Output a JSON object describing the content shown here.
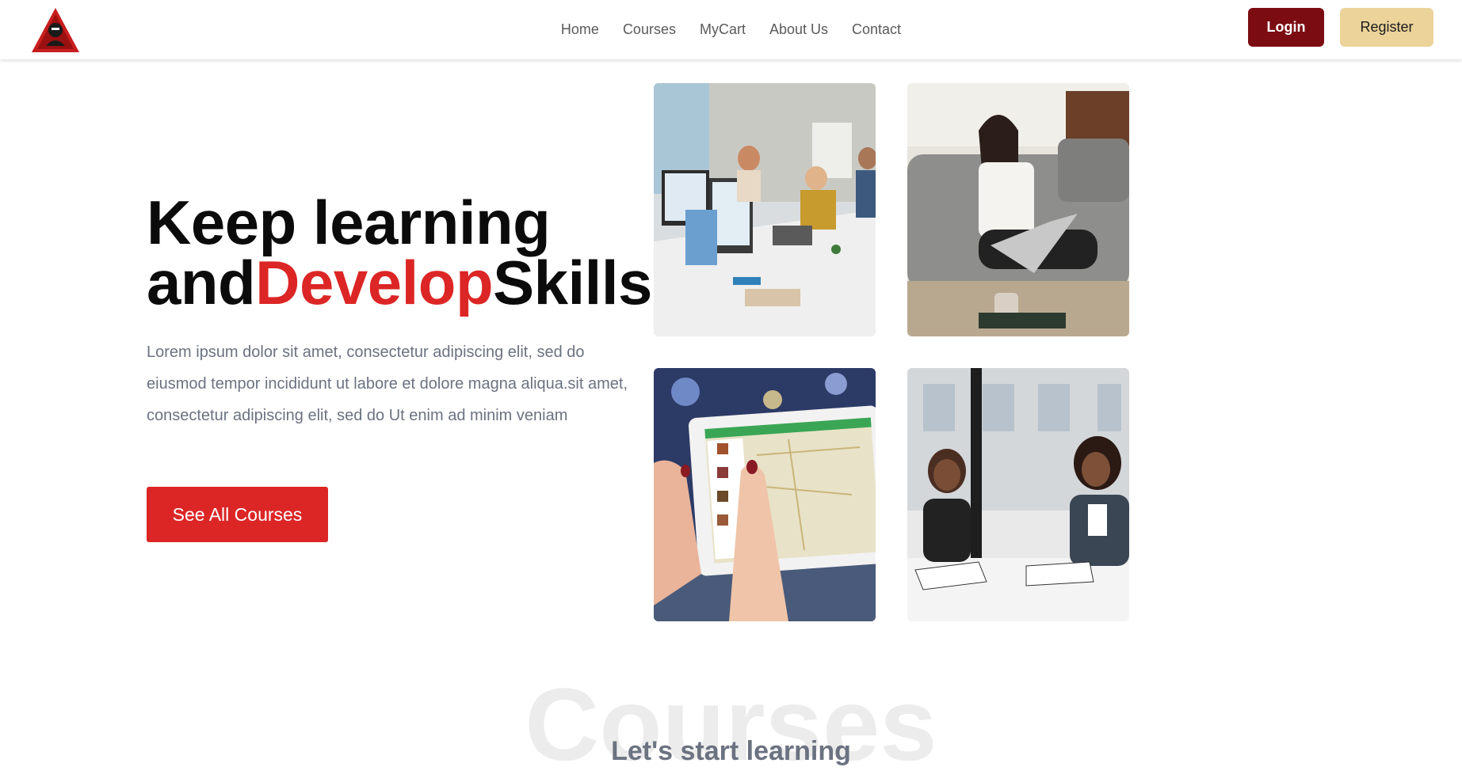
{
  "nav": {
    "links": [
      "Home",
      "Courses",
      "MyCart",
      "About Us",
      "Contact"
    ],
    "login_label": "Login",
    "register_label": "Register"
  },
  "hero": {
    "title_line1": "Keep learning",
    "title_and": "and",
    "title_accent": "Develop",
    "title_end": "Skills",
    "description": "Lorem ipsum dolor sit amet, consectetur adipiscing elit, sed do eiusmod tempor incididunt ut labore et dolore magna aliqua.sit amet, consectetur adipiscing elit, sed do Ut enim ad minim veniam",
    "cta_label": "See All Courses"
  },
  "courses_section": {
    "watermark": "Courses",
    "subtitle": "Let's start learning"
  },
  "colors": {
    "accent": "#dc2626",
    "login_bg": "#7b0d12",
    "register_bg": "#ecd39a"
  },
  "icons": [
    "logo-icon"
  ]
}
